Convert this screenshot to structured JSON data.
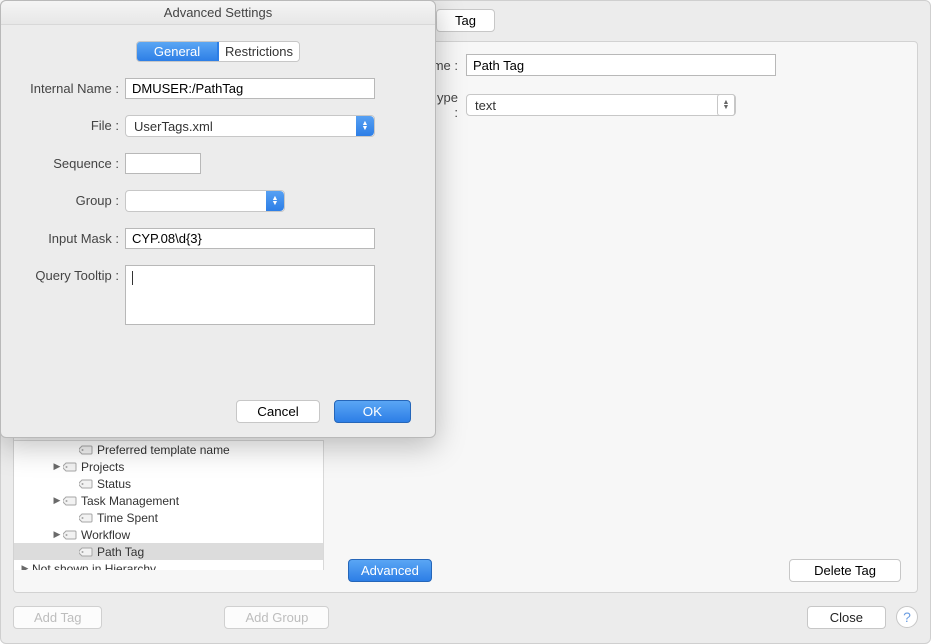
{
  "main": {
    "tag_button": "Tag",
    "name_label_partial": "me :",
    "name_value": "Path Tag",
    "type_label_partial": "ype :",
    "type_value": "text",
    "advanced_button": "Advanced",
    "delete_tag_button": "Delete Tag"
  },
  "tree": {
    "items": [
      {
        "label": "Preferred template name",
        "indent": 3,
        "disclosure": "",
        "selected": false
      },
      {
        "label": "Projects",
        "indent": 2,
        "disclosure": "right",
        "selected": false
      },
      {
        "label": "Status",
        "indent": 3,
        "disclosure": "",
        "selected": false
      },
      {
        "label": "Task Management",
        "indent": 2,
        "disclosure": "right",
        "selected": false
      },
      {
        "label": "Time Spent",
        "indent": 3,
        "disclosure": "",
        "selected": false
      },
      {
        "label": "Workflow",
        "indent": 2,
        "disclosure": "right",
        "selected": false
      },
      {
        "label": "Path Tag",
        "indent": 3,
        "disclosure": "",
        "selected": true
      }
    ],
    "not_shown": "Not shown in Hierarchy"
  },
  "footer": {
    "add_tag": "Add Tag",
    "add_group": "Add Group",
    "close": "Close",
    "help": "?"
  },
  "modal": {
    "title": "Advanced Settings",
    "tabs": {
      "general": "General",
      "restrictions": "Restrictions"
    },
    "fields": {
      "internal_name_label": "Internal Name :",
      "internal_name_value": "DMUSER:/PathTag",
      "file_label": "File :",
      "file_value": "UserTags.xml",
      "sequence_label": "Sequence :",
      "sequence_value": "",
      "group_label": "Group :",
      "group_value": "",
      "input_mask_label": "Input Mask :",
      "input_mask_value": "CYP.08\\d{3}",
      "query_tooltip_label": "Query Tooltip :",
      "query_tooltip_value": ""
    },
    "actions": {
      "cancel": "Cancel",
      "ok": "OK"
    }
  }
}
